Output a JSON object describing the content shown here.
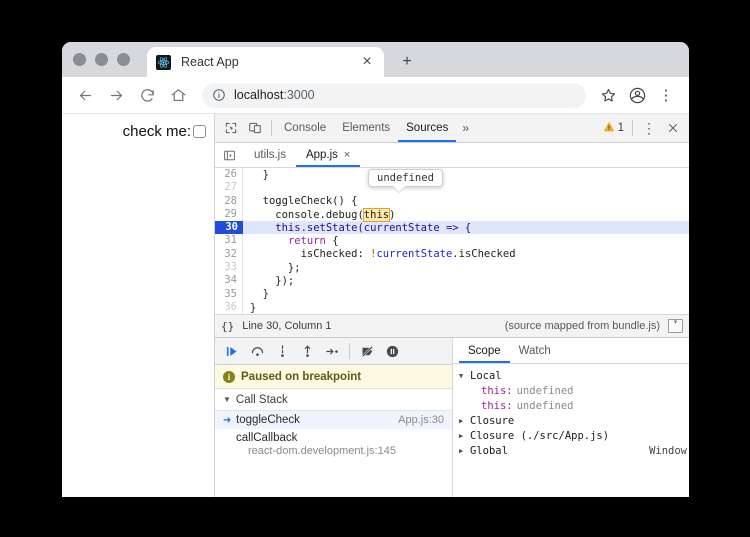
{
  "browser": {
    "tab": {
      "title": "React App",
      "favicon": "react-logo-icon",
      "close": "×"
    },
    "newtab_label": "+",
    "nav": {
      "back": "←",
      "forward": "→",
      "reload": "⟳",
      "home": "⌂"
    },
    "omnibox": {
      "info_icon": "info-circle-icon",
      "host": "localhost",
      "port": ":3000"
    },
    "actions": {
      "bookmark": "☆",
      "profile": "profile-avatar-icon",
      "menu": "⋮"
    }
  },
  "page": {
    "label": "check me:",
    "checkbox_checked": false
  },
  "devtools": {
    "toolbar": {
      "inspect_icon": "inspect-element-icon",
      "device_icon": "device-toolbar-icon",
      "tabs": [
        {
          "label": "Console",
          "active": false
        },
        {
          "label": "Elements",
          "active": false
        },
        {
          "label": "Sources",
          "active": true
        }
      ],
      "more_tabs": "»",
      "warning_icon": "warning-triangle-icon",
      "warning_count": "1",
      "menu": "⋮",
      "close": "×"
    },
    "file_tabs": {
      "navigator_toggle": "show-navigator-icon",
      "items": [
        {
          "label": "utils.js",
          "active": false,
          "closable": false
        },
        {
          "label": "App.js",
          "active": true,
          "closable": true,
          "close": "×"
        }
      ]
    },
    "tooltip": {
      "text": "undefined"
    },
    "code": {
      "lines": [
        {
          "num": "26",
          "dim": false,
          "current": false,
          "text": "  }"
        },
        {
          "num": "27",
          "dim": true,
          "current": false,
          "text": ""
        },
        {
          "num": "28",
          "dim": false,
          "current": false,
          "text": "  toggleCheck() {"
        },
        {
          "num": "29",
          "dim": false,
          "current": false,
          "text": "    console.debug(this)"
        },
        {
          "num": "30",
          "dim": false,
          "current": true,
          "text": "    this.setState(currentState => {"
        },
        {
          "num": "31",
          "dim": false,
          "current": false,
          "text": "      return {"
        },
        {
          "num": "32",
          "dim": false,
          "current": false,
          "text": "        isChecked: !currentState.isChecked"
        },
        {
          "num": "33",
          "dim": true,
          "current": false,
          "text": "      };"
        },
        {
          "num": "34",
          "dim": false,
          "current": false,
          "text": "    });"
        },
        {
          "num": "35",
          "dim": false,
          "current": false,
          "text": "  }"
        },
        {
          "num": "36",
          "dim": true,
          "current": false,
          "text": "}"
        }
      ]
    },
    "statusbar": {
      "format_icon": "{}",
      "position": "Line 30, Column 1",
      "source_map": "(source mapped from bundle.js)",
      "popout_icon": "popout-icon"
    },
    "debug_controls": [
      {
        "name": "resume-script-execution",
        "icon": "resume-icon",
        "primary": true
      },
      {
        "name": "step-over-next-function-call",
        "icon": "step-over-icon",
        "primary": false
      },
      {
        "name": "step-into-next-function-call",
        "icon": "step-into-icon",
        "primary": false
      },
      {
        "name": "step-out-of-current-function",
        "icon": "step-out-icon",
        "primary": false
      },
      {
        "name": "step",
        "icon": "step-icon",
        "primary": false
      },
      {
        "name": "deactivate-breakpoints",
        "icon": "deactivate-breakpoints-icon",
        "primary": false
      },
      {
        "name": "pause-on-exceptions",
        "icon": "pause-on-exceptions-icon",
        "primary": false
      }
    ],
    "paused": {
      "icon": "info-icon",
      "text": "Paused on breakpoint"
    },
    "call_stack": {
      "title": "Call Stack",
      "frames": [
        {
          "name": "toggleCheck",
          "location": "App.js:30",
          "selected": true,
          "multiline": false
        },
        {
          "name": "callCallback",
          "location": "react-dom.development.js:145",
          "selected": false,
          "multiline": true
        }
      ]
    },
    "scope_panel": {
      "tabs": [
        {
          "label": "Scope",
          "active": true
        },
        {
          "label": "Watch",
          "active": false
        }
      ],
      "rows": [
        {
          "kind": "group",
          "expanded": true,
          "label": "Local",
          "value": ""
        },
        {
          "kind": "prop",
          "expanded": false,
          "label": "this:",
          "value": "undefined"
        },
        {
          "kind": "prop",
          "expanded": false,
          "label": "this:",
          "value": "undefined"
        },
        {
          "kind": "group",
          "expanded": false,
          "label": "Closure",
          "value": ""
        },
        {
          "kind": "group",
          "expanded": false,
          "label": "Closure (./src/App.js)",
          "value": ""
        },
        {
          "kind": "group",
          "expanded": false,
          "label": "Global",
          "value": "Window"
        }
      ]
    }
  },
  "colors": {
    "accent": "#1a73e8",
    "warning": "#e8a317",
    "paused_bg": "#fdf9e2",
    "current_line_bg": "#dfe6fb",
    "gutter_current_bg": "#1f4fd8"
  }
}
